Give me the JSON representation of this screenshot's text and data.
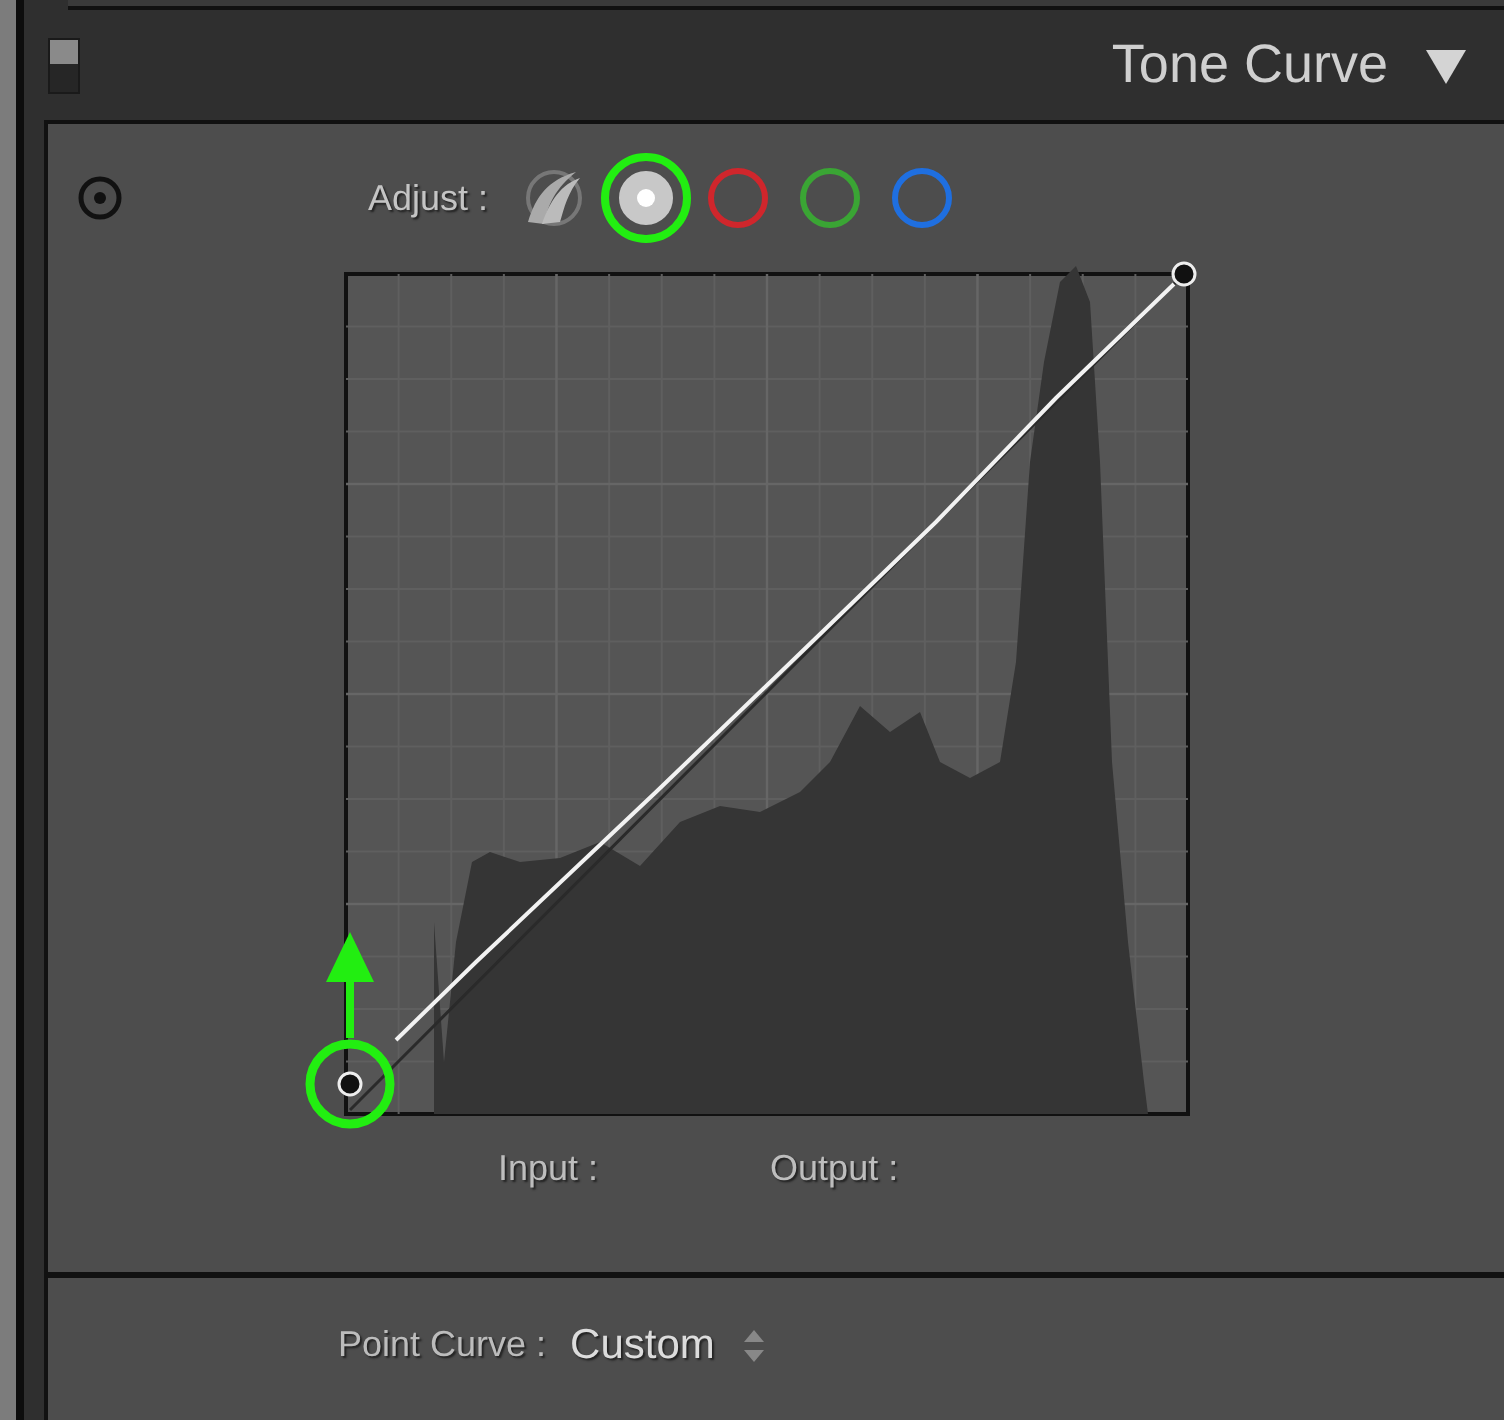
{
  "header": {
    "panel_switch_on": true,
    "title": "Tone Curve",
    "expanded": true
  },
  "adjust": {
    "label": "Adjust :",
    "channels": [
      {
        "kind": "parametric",
        "selected": false
      },
      {
        "kind": "rgb",
        "selected": true
      },
      {
        "kind": "channel",
        "color": "#d0262c",
        "selected": false
      },
      {
        "kind": "channel",
        "color": "#3aa534",
        "selected": false
      },
      {
        "kind": "channel",
        "color": "#1f6fe0",
        "selected": false
      }
    ]
  },
  "readout": {
    "input_label": "Input :",
    "output_label": "Output :"
  },
  "point_curve": {
    "label": "Point Curve :",
    "value": "Custom"
  }
}
